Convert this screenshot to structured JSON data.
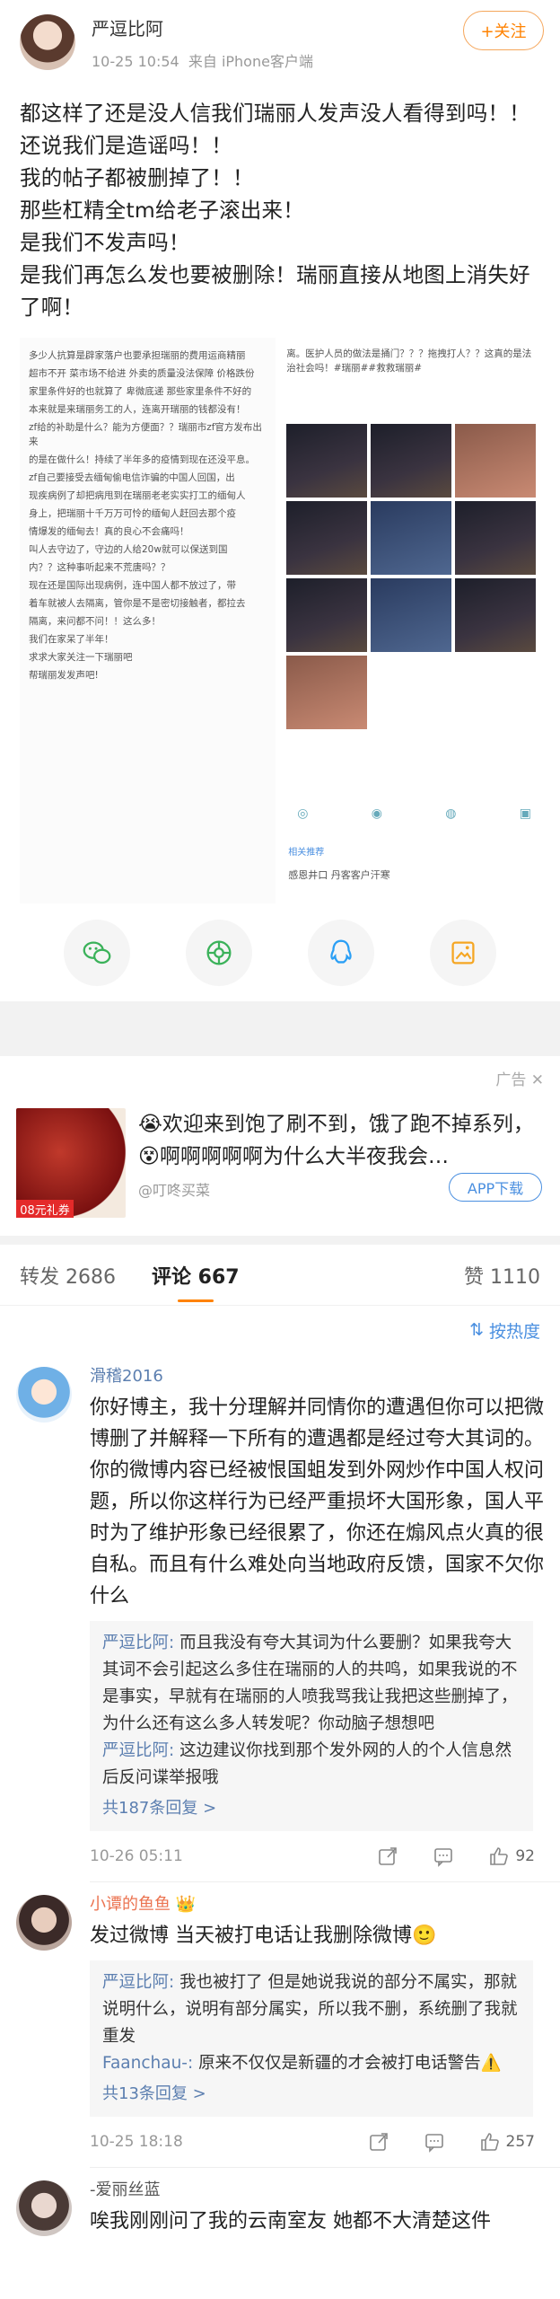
{
  "post": {
    "author": "严逗比阿",
    "time": "10-25 10:54",
    "source": "来自 iPhone客户端",
    "follow_label": "+关注",
    "text": [
      "都这样了还是没人信我们瑞丽人发声没人看得到吗！！",
      "还说我们是造谣吗！！",
      "我的帖子都被删掉了！！",
      "那些杠精全tm给老子滚出来！",
      "是我们不发声吗！",
      "是我们再怎么发也要被删除！瑞丽直接从地图上消失好了啊！"
    ],
    "image_left_text": [
      "多少人抗算是辟家落户也要承担瑞丽的费用运商精丽",
      "超市不开 菜市场不给进 外卖的质量没法保障 价格跌份",
      "家里条件好的也就算了 卑微底递 那些家里条件不好的",
      "本来就是来瑞丽务工的人，连离开瑞丽的钱都没有！",
      "zf给的补助是什么？能为方便面？？瑞丽市zf官方发布出来",
      "的是在做什么！持续了半年多的疫情到现在还没平息。",
      "zf自己要接受去缅甸偷电信诈骗的中国人回国，出",
      "现疾病例了却把病甩到在瑞丽老老实实打工的缅甸人",
      "身上，把瑞丽十千万万可怜的缅甸人赶回去那个疫",
      "情爆发的缅甸去！真的良心不会痛吗！",
      "叫人去守边了，守边的人给20w就可以保送到国",
      "内？？这种事听起来不荒唐吗？？",
      "现在还是国际出现病例，连中国人都不放过了，带",
      "着车就被人去隔离，管你是不是密切接触者，都拉去",
      "隔离，来问都不问！！这么多！",
      "我们在家呆了半年！",
      "求求大家关注一下瑞丽吧",
      "帮瑞丽发发声吧!"
    ],
    "image_right_caption": "离。医护人员的做法是捅门？？？拖拽打人？？这真的是法治社会吗！#瑞丽##救救瑞丽#",
    "image_right_rec": "相关推荐",
    "image_right_rec2": "感恩井口    丹客客户汗寒"
  },
  "ad": {
    "label": "广告",
    "image_tag": "08元礼券",
    "text": "😭欢迎来到饱了刷不到，饿了跑不掉系列，😵啊啊啊啊啊为什么大半夜我会…",
    "source": "@叮咚买菜",
    "button": "APP下载"
  },
  "tabs": {
    "forward": "转发 2686",
    "comments": "评论 667",
    "likes": "赞 1110"
  },
  "sort_label": "按热度",
  "comments": [
    {
      "name": "滑稽2016",
      "text": "你好博主，我十分理解并同情你的遭遇但你可以把微博删了并解释一下所有的遭遇都是经过夸大其词的。你的微博内容已经被恨国蛆发到外网炒作中国人权问题，所以你这样行为已经严重损坏大国形象，国人平时为了维护形象已经很累了，你还在煽风点火真的很自私。而且有什么难处向当地政府反馈，国家不欠你什么",
      "replies": [
        {
          "author": "严逗比阿:",
          "text": " 而且我没有夸大其词为什么要删？如果我夸大其词不会引起这么多住在瑞丽的人的共鸣，如果我说的不是事实，早就有在瑞丽的人喷我骂我让我把这些删掉了，为什么还有这么多人转发呢？你动脑子想想吧"
        },
        {
          "author": "严逗比阿:",
          "text": " 这边建议你找到那个发外网的人的个人信息然后反问谍举报哦"
        }
      ],
      "more": "共187条回复 >",
      "time": "10-26 05:11",
      "likes": "92"
    },
    {
      "name": "小谭的鱼鱼 👑",
      "text": "发过微博 当天被打电话让我删除微博🙂",
      "replies": [
        {
          "author": "严逗比阿:",
          "text": " 我也被打了 但是她说我说的部分不属实，那就说明什么，说明有部分属实，所以我不删，系统删了我就重发"
        },
        {
          "author": "Faanchau-:",
          "text": " 原来不仅仅是新疆的才会被打电话警告⚠️"
        }
      ],
      "more": "共13条回复 >",
      "time": "10-25 18:18",
      "likes": "257"
    },
    {
      "name": "-爱丽丝蓝",
      "text": "唉我刚刚问了我的云南室友 她都不大清楚这件",
      "replies": [],
      "more": "",
      "time": "",
      "likes": ""
    }
  ]
}
